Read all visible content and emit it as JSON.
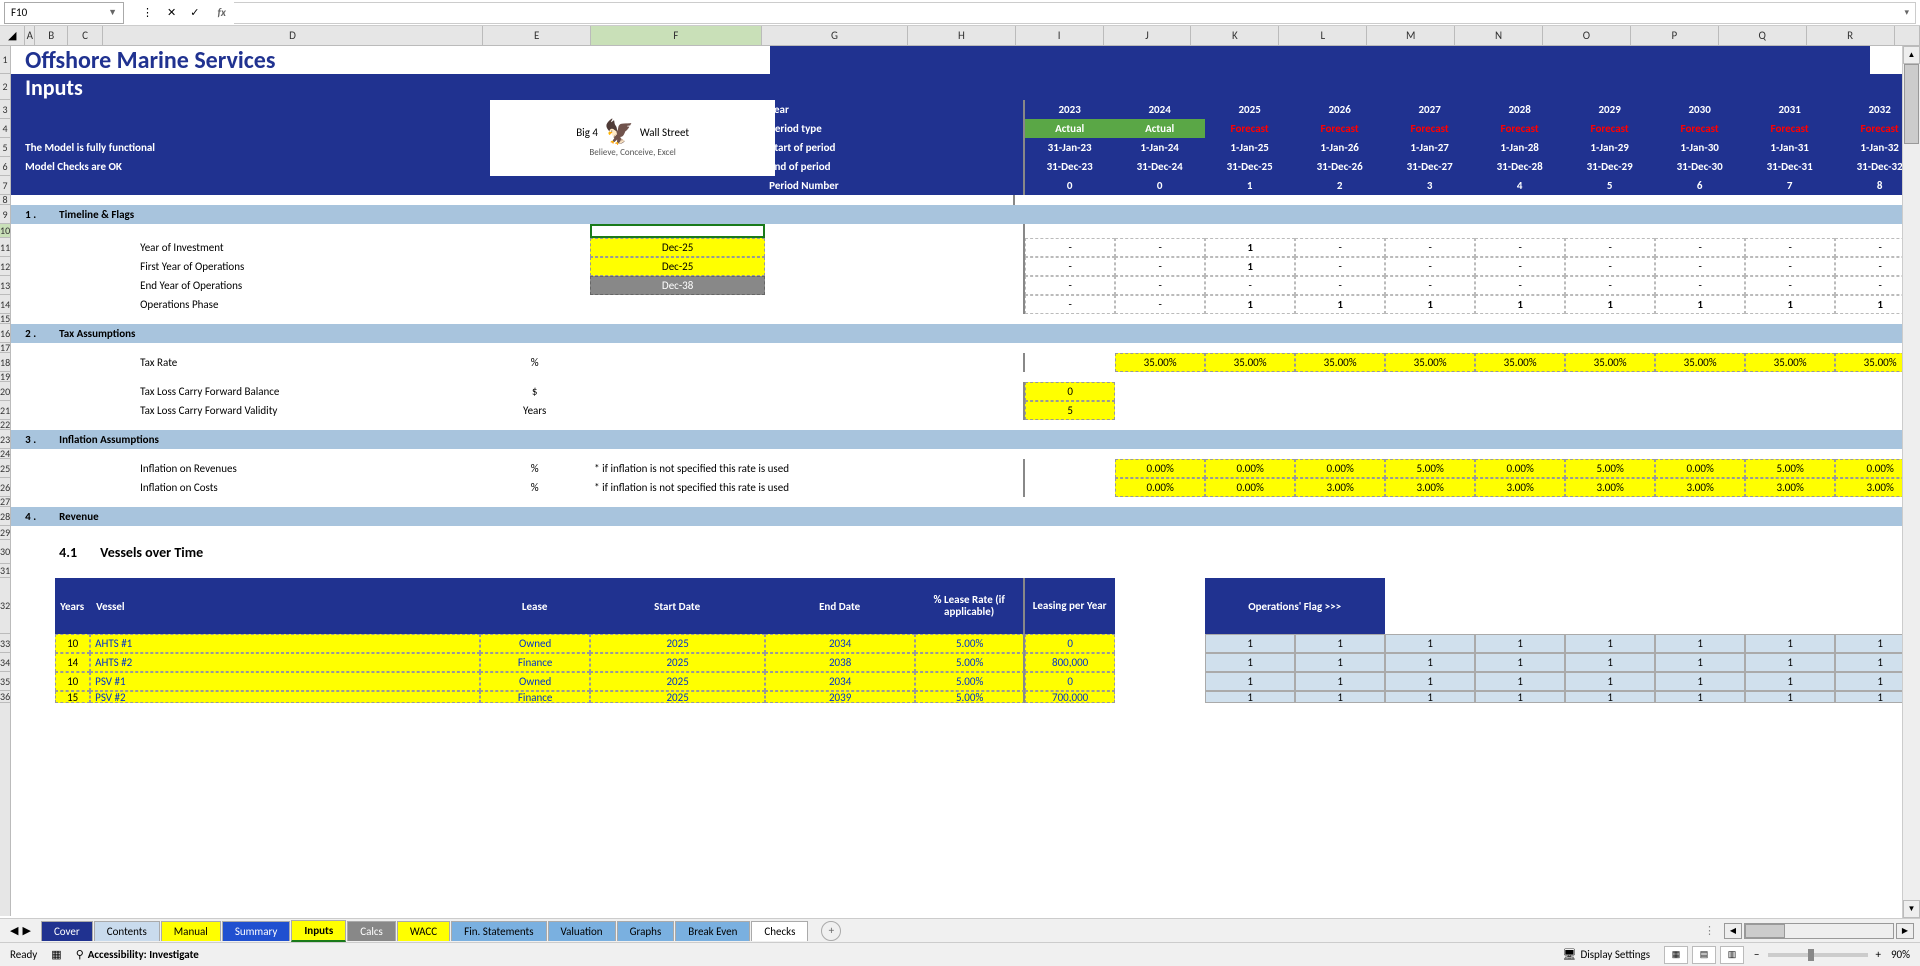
{
  "nameBox": "F10",
  "columns": [
    "A",
    "B",
    "C",
    "D",
    "E",
    "F",
    "G",
    "H",
    "I",
    "J",
    "K",
    "L",
    "M",
    "N",
    "O",
    "P",
    "Q",
    "R"
  ],
  "rows": [
    "1",
    "2",
    "3",
    "4",
    "5",
    "6",
    "7",
    "8",
    "9",
    "10",
    "11",
    "12",
    "13",
    "14",
    "15",
    "16",
    "17",
    "18",
    "19",
    "20",
    "21",
    "22",
    "23",
    "24",
    "25",
    "26",
    "27",
    "28",
    "29",
    "30",
    "31",
    "32",
    "33",
    "34",
    "35",
    "36"
  ],
  "title1": "Offshore Marine Services",
  "title2": "Inputs",
  "status1": "The Model is fully functional",
  "status2": "Model Checks are OK",
  "logo": {
    "main1": "Big 4",
    "main2": "Wall Street",
    "sub": "Believe, Conceive, Excel"
  },
  "hdrLabels": {
    "year": "Year",
    "ptype": "Period type",
    "sop": "Start of period",
    "eop": "End of period",
    "pnum": "Period Number"
  },
  "years": [
    "2023",
    "2024",
    "2025",
    "2026",
    "2027",
    "2028",
    "2029",
    "2030",
    "2031",
    "2032"
  ],
  "ptype": [
    "Actual",
    "Actual",
    "Forecast",
    "Forecast",
    "Forecast",
    "Forecast",
    "Forecast",
    "Forecast",
    "Forecast",
    "Forecast"
  ],
  "sop": [
    "31-Jan-23",
    "1-Jan-24",
    "1-Jan-25",
    "1-Jan-26",
    "1-Jan-27",
    "1-Jan-28",
    "1-Jan-29",
    "1-Jan-30",
    "1-Jan-31",
    "1-Jan-32"
  ],
  "eop": [
    "31-Dec-23",
    "31-Dec-24",
    "31-Dec-25",
    "31-Dec-26",
    "31-Dec-27",
    "31-Dec-28",
    "31-Dec-29",
    "31-Dec-30",
    "31-Dec-31",
    "31-Dec-32"
  ],
  "pnum": [
    "0",
    "0",
    "1",
    "2",
    "3",
    "4",
    "5",
    "6",
    "7",
    "8"
  ],
  "sec1": {
    "num": "1 .",
    "name": "Timeline & Flags"
  },
  "timeline": {
    "row1": {
      "label": "Year of Investment",
      "val": "Dec-25",
      "flags": [
        "-",
        "-",
        "1",
        "-",
        "-",
        "-",
        "-",
        "-",
        "-",
        "-"
      ]
    },
    "row2": {
      "label": "First Year of Operations",
      "val": "Dec-25",
      "flags": [
        "-",
        "-",
        "1",
        "-",
        "-",
        "-",
        "-",
        "-",
        "-",
        "-"
      ]
    },
    "row3": {
      "label": "End Year of Operations",
      "val": "Dec-38",
      "flags": [
        "-",
        "-",
        "-",
        "-",
        "-",
        "-",
        "-",
        "-",
        "-",
        "-"
      ]
    },
    "row4": {
      "label": "Operations Phase",
      "flags": [
        "-",
        "-",
        "1",
        "1",
        "1",
        "1",
        "1",
        "1",
        "1",
        "1"
      ]
    }
  },
  "sec2": {
    "num": "2 .",
    "name": "Tax Assumptions"
  },
  "tax": {
    "rate": {
      "label": "Tax Rate",
      "unit": "%",
      "vals": [
        "",
        "35.00%",
        "35.00%",
        "35.00%",
        "35.00%",
        "35.00%",
        "35.00%",
        "35.00%",
        "35.00%",
        "35.00%"
      ]
    },
    "bal": {
      "label": "Tax Loss Carry Forward Balance",
      "unit": "$",
      "val": "0"
    },
    "validity": {
      "label": "Tax Loss Carry Forward Validity",
      "unit": "Years",
      "val": "5"
    }
  },
  "sec3": {
    "num": "3 .",
    "name": "Inflation Assumptions"
  },
  "inflation": {
    "note": "* if inflation is not specified this rate is used",
    "rev": {
      "label": "Inflation on Revenues",
      "unit": "%",
      "vals": [
        "",
        "0.00%",
        "0.00%",
        "0.00%",
        "5.00%",
        "0.00%",
        "5.00%",
        "0.00%",
        "5.00%",
        "0.00%"
      ]
    },
    "cost": {
      "label": "Inflation on Costs",
      "unit": "%",
      "vals": [
        "",
        "0.00%",
        "0.00%",
        "3.00%",
        "3.00%",
        "3.00%",
        "3.00%",
        "3.00%",
        "3.00%",
        "3.00%"
      ]
    }
  },
  "sec4": {
    "num": "4 .",
    "name": "Revenue"
  },
  "sec41": {
    "num": "4.1",
    "name": "Vessels over Time"
  },
  "vesselsHdr": {
    "years": "Years",
    "vessel": "Vessel",
    "lease": "Lease",
    "start": "Start Date",
    "end": "End Date",
    "pct": "% Lease Rate (if applicable)",
    "leasing": "Leasing per Year",
    "ops": "Operations' Flag >>>"
  },
  "vessels": [
    {
      "y": "10",
      "name": "AHTS #1",
      "lease": "Owned",
      "start": "2025",
      "end": "2034",
      "pct": "5.00%",
      "lpy": "0",
      "flags": [
        "1",
        "1",
        "1",
        "1",
        "1",
        "1",
        "1",
        "1"
      ]
    },
    {
      "y": "14",
      "name": "AHTS #2",
      "lease": "Finance",
      "start": "2025",
      "end": "2038",
      "pct": "5.00%",
      "lpy": "800,000",
      "flags": [
        "1",
        "1",
        "1",
        "1",
        "1",
        "1",
        "1",
        "1"
      ]
    },
    {
      "y": "10",
      "name": "PSV #1",
      "lease": "Owned",
      "start": "2025",
      "end": "2034",
      "pct": "5.00%",
      "lpy": "0",
      "flags": [
        "1",
        "1",
        "1",
        "1",
        "1",
        "1",
        "1",
        "1"
      ]
    },
    {
      "y": "15",
      "name": "PSV #2",
      "lease": "Finance",
      "start": "2025",
      "end": "2039",
      "pct": "5.00%",
      "lpy": "700,000",
      "flags": [
        "1",
        "1",
        "1",
        "1",
        "1",
        "1",
        "1",
        "1"
      ]
    }
  ],
  "tabs": [
    "Cover",
    "Contents",
    "Manual",
    "Summary",
    "Inputs",
    "Calcs",
    "WACC",
    "Fin. Statements",
    "Valuation",
    "Graphs",
    "Break Even",
    "Checks"
  ],
  "statusBar": {
    "ready": "Ready",
    "acc": "Accessibility: Investigate",
    "display": "Display Settings",
    "zoom": "90%"
  }
}
